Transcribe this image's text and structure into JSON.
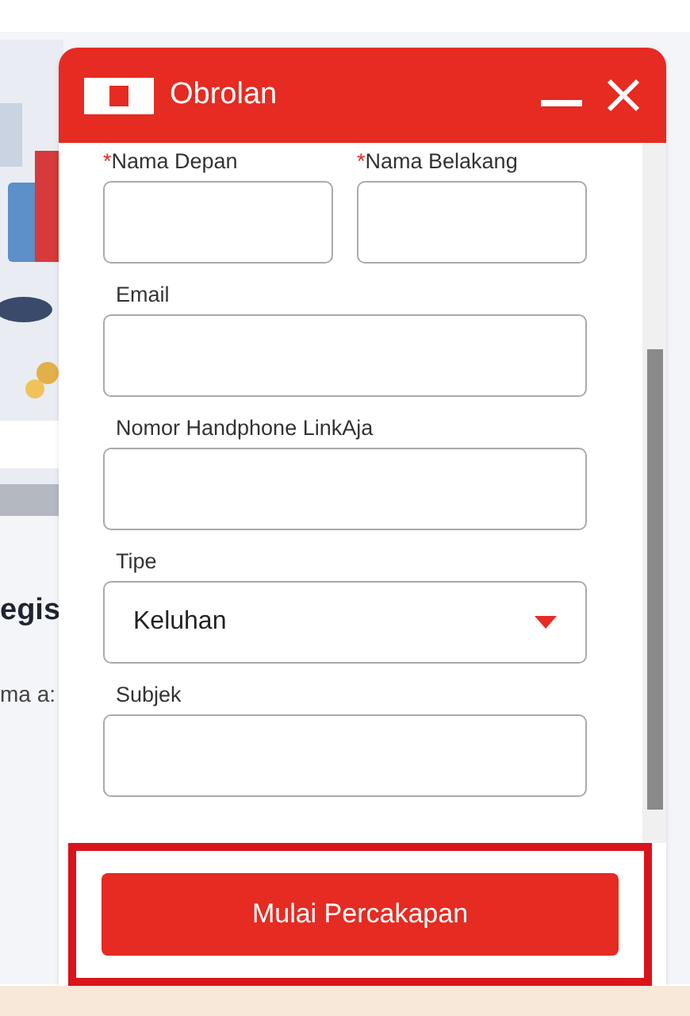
{
  "background_page": {
    "heading": "egis",
    "text": "ma a:"
  },
  "chat_window": {
    "title": "Obrolan",
    "fields": [
      {
        "required_mark": "*",
        "label": "Nama Depan",
        "kind": "text"
      },
      {
        "required_mark": "*",
        "label": "Nama Belakang",
        "kind": "text"
      },
      {
        "label": "Email",
        "kind": "text"
      },
      {
        "label": "Nomor Handphone LinkAja",
        "kind": "text"
      },
      {
        "label": "Tipe",
        "kind": "select",
        "value": "Keluhan"
      },
      {
        "label": "Subjek",
        "kind": "text"
      }
    ],
    "submit_button": "Mulai Percakapan"
  }
}
